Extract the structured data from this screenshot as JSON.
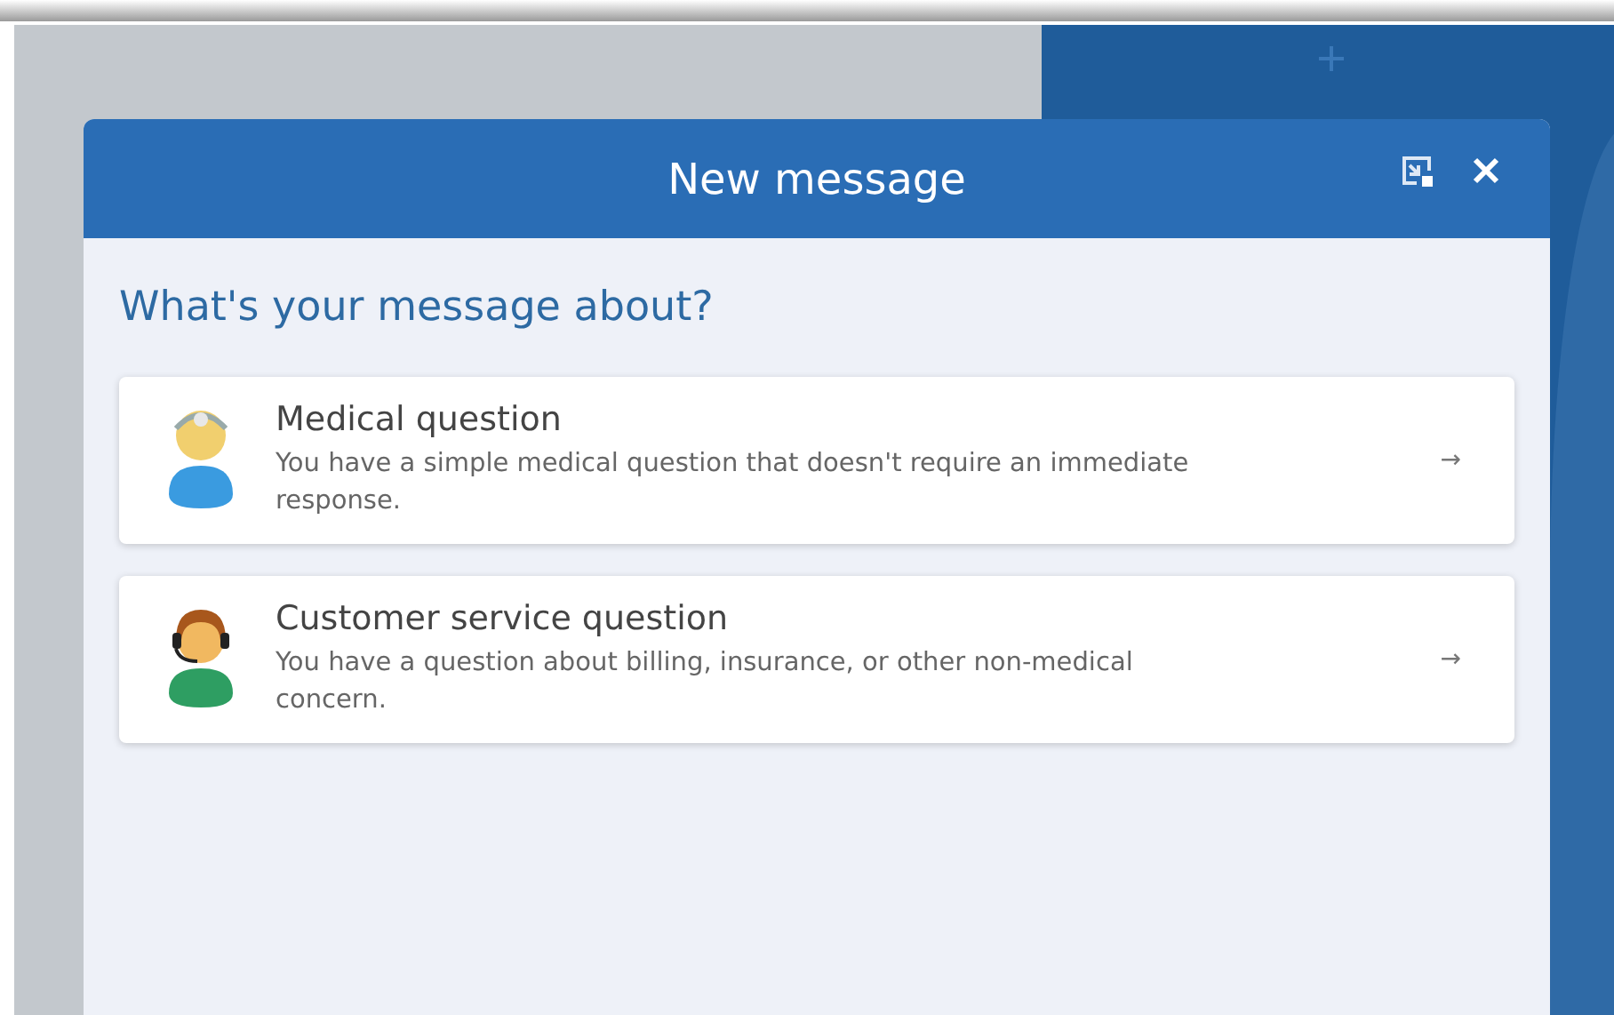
{
  "dialog": {
    "title": "New message",
    "heading": "What's your message about?"
  },
  "options": [
    {
      "kind": "doctor",
      "title": "Medical question",
      "description": "You have a simple medical question that doesn't require an immediate response.",
      "arrow": "→"
    },
    {
      "kind": "agent",
      "title": "Customer service question",
      "description": "You have a question about billing, insurance, or other non-medical concern.",
      "arrow": "→"
    }
  ]
}
